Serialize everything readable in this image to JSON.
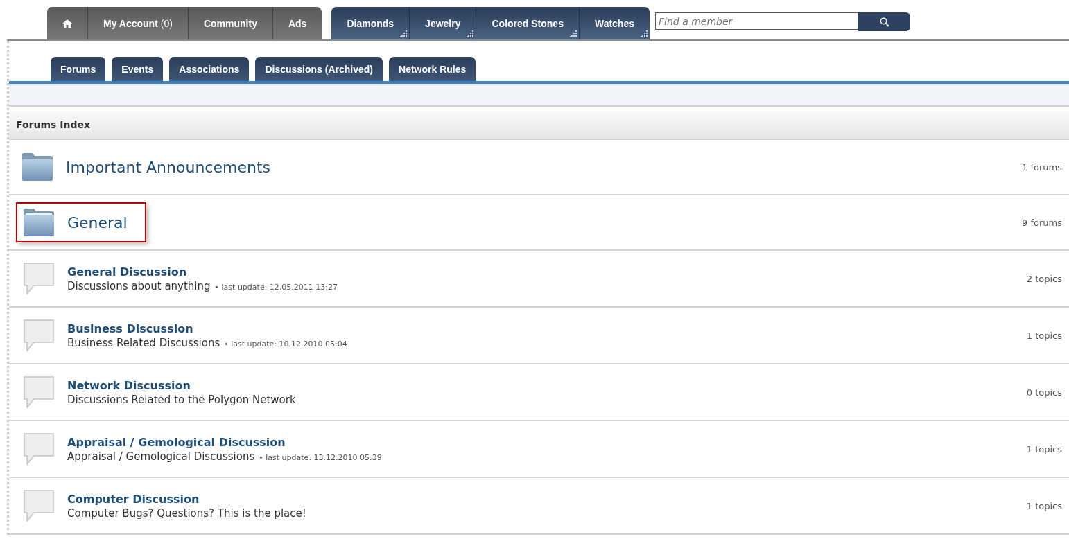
{
  "main_nav": {
    "account_tabs": [
      {
        "kind": "home"
      },
      {
        "kind": "label",
        "label": "My Account",
        "count": "(0)"
      },
      {
        "kind": "label",
        "label": "Community"
      },
      {
        "kind": "label",
        "label": "Ads"
      }
    ],
    "shop_tabs": [
      {
        "label": "Diamonds"
      },
      {
        "label": "Jewelry"
      },
      {
        "label": "Colored Stones"
      },
      {
        "label": "Watches"
      }
    ],
    "search": {
      "placeholder": "Find a member"
    }
  },
  "sub_tabs": [
    {
      "label": "Forums"
    },
    {
      "label": "Events"
    },
    {
      "label": "Associations"
    },
    {
      "label": "Discussions (Archived)"
    },
    {
      "label": "Network Rules"
    }
  ],
  "forums_index": {
    "title": "Forums Index",
    "rows": [
      {
        "kind": "category",
        "title": "Important Announcements",
        "count": "1 forums",
        "highlighted": false
      },
      {
        "kind": "category",
        "title": "General",
        "count": "9 forums",
        "highlighted": true
      },
      {
        "kind": "forum",
        "title": "General Discussion",
        "description": "Discussions about anything",
        "last_update": "• last update: 12.05.2011 13:27",
        "count": "2 topics"
      },
      {
        "kind": "forum",
        "title": "Business Discussion",
        "description": "Business Related Discussions",
        "last_update": "• last update: 10.12.2010 05:04",
        "count": "1 topics"
      },
      {
        "kind": "forum",
        "title": "Network Discussion",
        "description": "Discussions Related to the Polygon Network",
        "count": "0 topics"
      },
      {
        "kind": "forum",
        "title": "Appraisal / Gemological Discussion",
        "description": "Appraisal / Gemological Discussions",
        "last_update": "• last update: 13.12.2010 05:39",
        "count": "1 topics"
      },
      {
        "kind": "forum",
        "title": "Computer Discussion",
        "description": "Computer Bugs? Questions? This is the place!",
        "count": "1 topics"
      }
    ]
  }
}
